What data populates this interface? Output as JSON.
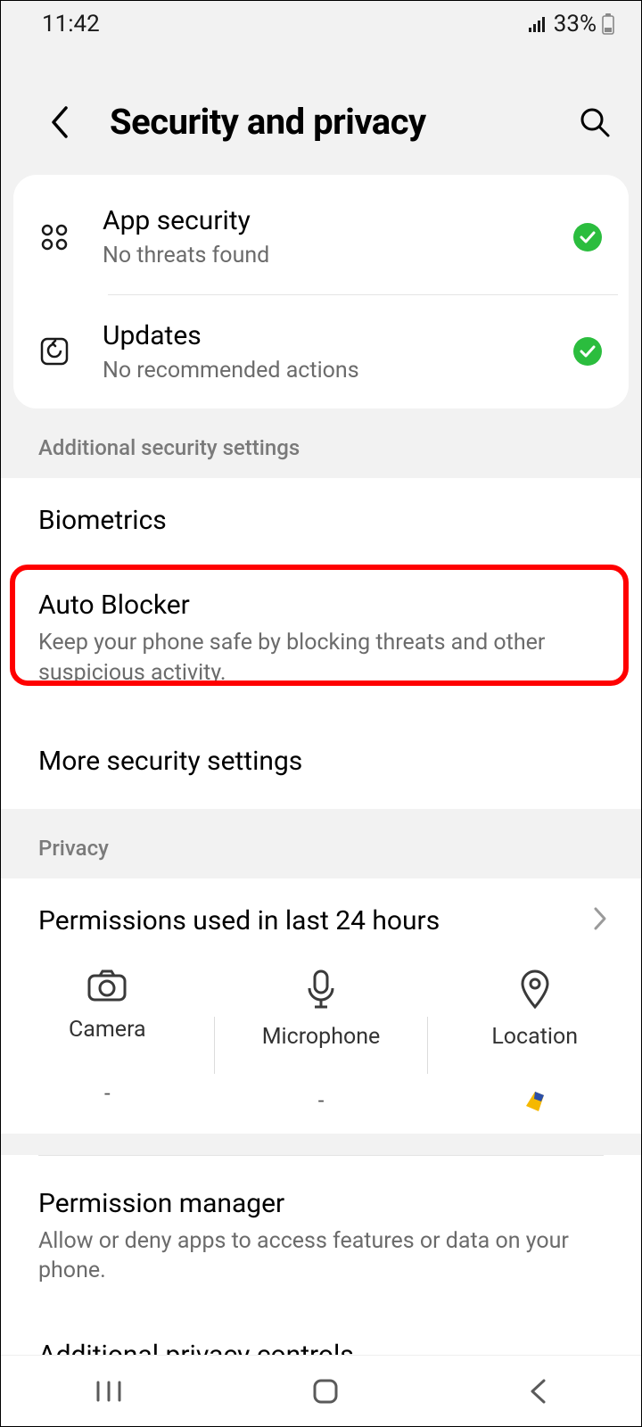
{
  "statusBar": {
    "time": "11:42",
    "battery": "33%"
  },
  "header": {
    "title": "Security and privacy"
  },
  "statusCard": {
    "appSecurity": {
      "title": "App security",
      "sub": "No threats found"
    },
    "updates": {
      "title": "Updates",
      "sub": "No recommended actions"
    }
  },
  "sections": {
    "additional": "Additional security settings",
    "privacy": "Privacy"
  },
  "items": {
    "biometrics": {
      "title": "Biometrics"
    },
    "autoBlocker": {
      "title": "Auto Blocker",
      "sub": "Keep your phone safe by blocking threats and other suspicious activity."
    },
    "moreSecurity": {
      "title": "More security settings"
    },
    "permissionsUsed": {
      "title": "Permissions used in last 24 hours"
    },
    "permissionManager": {
      "title": "Permission manager",
      "sub": "Allow or deny apps to access features or data on your phone."
    },
    "additionalPrivacy": {
      "title": "Additional privacy controls"
    }
  },
  "perms": {
    "camera": {
      "label": "Camera",
      "value": "-"
    },
    "microphone": {
      "label": "Microphone",
      "value": "-"
    },
    "location": {
      "label": "Location",
      "value": ""
    }
  }
}
